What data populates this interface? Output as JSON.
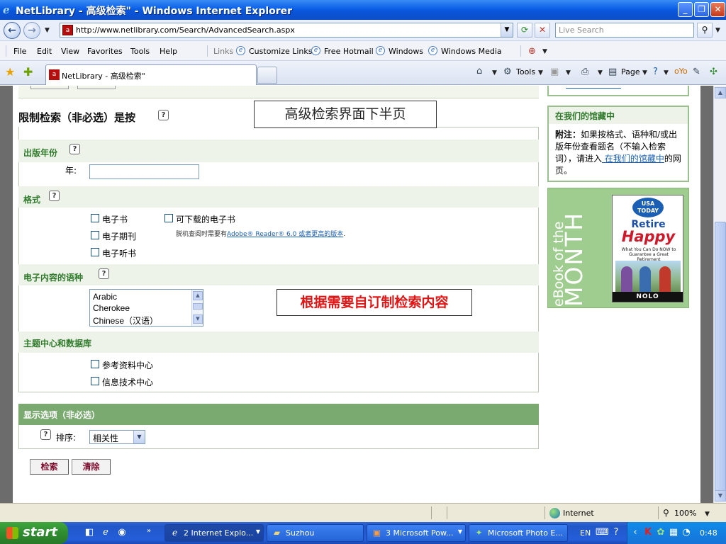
{
  "window": {
    "title": "NetLibrary - 高级检索\" - Windows Internet Explorer",
    "minimize": "_",
    "restore": "❐",
    "close": "✕"
  },
  "address_bar": {
    "url": "http://www.netlibrary.com/Search/AdvancedSearch.aspx",
    "search_placeholder": "Live Search"
  },
  "menu": {
    "items": [
      "File",
      "Edit",
      "View",
      "Favorites",
      "Tools",
      "Help"
    ],
    "links_label": "Links",
    "links": [
      "Customize Links",
      "Free Hotmail",
      "Windows",
      "Windows Media"
    ]
  },
  "tabs": {
    "active_tab": "NetLibrary - 高级检索\"",
    "tools_label": "Tools",
    "page_label": "Page"
  },
  "annotations": {
    "lower_half": "高级检索界面下半页",
    "customize": "根据需要自订制检索内容"
  },
  "limit_section": {
    "title": "限制检索（非必选）是按",
    "pub_year_header": "出版年份",
    "year_label": "年:",
    "format_header": "格式",
    "formats": [
      "电子书",
      "电子期刊",
      "电子听书"
    ],
    "downloadable": "可下载的电子书",
    "note_prefix": "脱机查阅时需要有",
    "note_link": "Adobe® Reader® 6.0 或者更高的版本",
    "note_suffix": ".",
    "language_header": "电子内容的语种",
    "languages": [
      "Arabic",
      "Cherokee",
      "Chinese（汉语）"
    ],
    "subject_header": "主题中心和数据库",
    "subjects": [
      "参考资料中心",
      "信息技术中心"
    ]
  },
  "display_section": {
    "header": "显示选项（非必选）",
    "sort_label": "排序:",
    "sort_value": "相关性"
  },
  "buttons": {
    "search": "检索",
    "clear": "清除"
  },
  "sidebar": {
    "library_header": "在我们的馆藏中",
    "note_bold": "附注：",
    "note_text": "如果按格式、语种和/或出版年份查看题名（不输入检索词），请进入",
    "note_link": " 在我们的馆藏中",
    "note_end": "的网页。",
    "ebook_small": "eBook of the",
    "ebook_large": "MONTH",
    "cover_badge": "USA TODAY",
    "cover_title1": "Retire",
    "cover_title2": "Happy",
    "cover_tagline": "What You Can Do NOW to Guarantee a Great Retirement",
    "cover_publisher": "NOLO"
  },
  "status_bar": {
    "zone": "Internet",
    "zoom": "100%"
  },
  "taskbar": {
    "start": "start",
    "buttons": [
      "2 Internet Explo...",
      "Suzhou",
      "3 Microsoft Pow...",
      "Microsoft Photo E..."
    ],
    "lang": "EN",
    "time": "0:48"
  }
}
